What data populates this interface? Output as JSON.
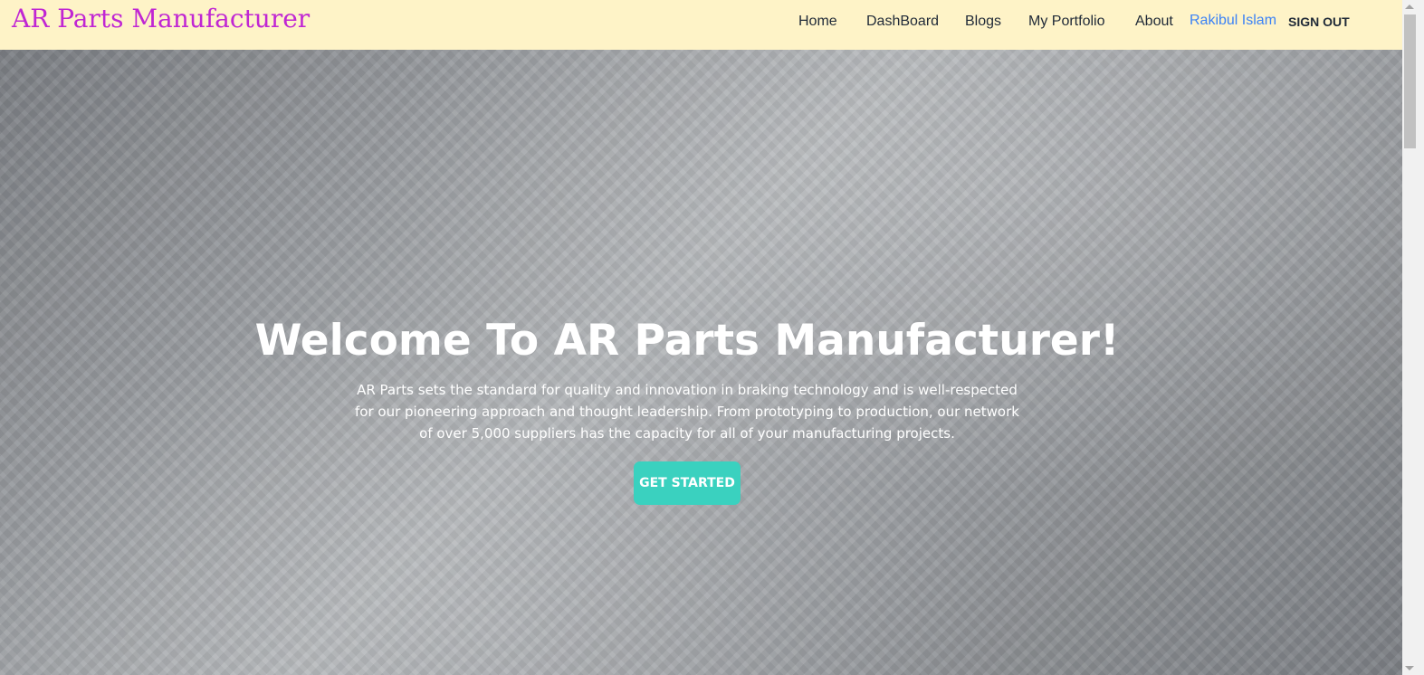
{
  "navbar": {
    "brand": "AR Parts Manufacturer",
    "items": [
      {
        "label": "Home"
      },
      {
        "label": "DashBoard"
      },
      {
        "label": "Blogs"
      },
      {
        "label": "My Portfolio"
      },
      {
        "label": "About"
      }
    ],
    "user_name": "Rakibul Islam",
    "signout_label": "SIGN OUT"
  },
  "hero": {
    "title": "Welcome To AR Parts Manufacturer!",
    "description": "AR Parts sets the standard for quality and innovation in braking technology and is well-respected for our pioneering approach and thought leadership. From prototyping to production, our network of over 5,000 suppliers has the capacity for all of your manufacturing projects.",
    "cta_label": "GET STARTED"
  },
  "colors": {
    "navbar_bg": "#fef3c7",
    "brand": "#c026d3",
    "user_link": "#3b82f6",
    "cta_bg": "#3ad1bf"
  }
}
